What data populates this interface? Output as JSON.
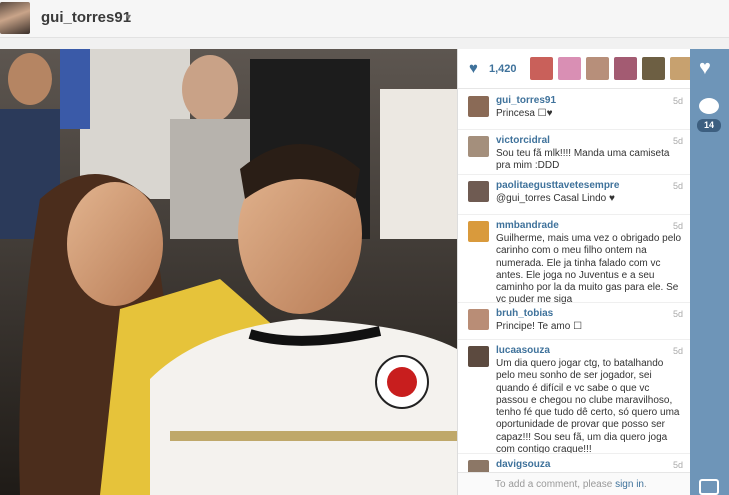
{
  "header": {
    "username": "gui_torres91",
    "caret": "▾"
  },
  "likes": {
    "count": "1,420",
    "heart": "♥"
  },
  "comments": [
    {
      "user": "gui_torres91",
      "time": "5d",
      "text": "Princesa ☐♥"
    },
    {
      "user": "victorcidral",
      "time": "5d",
      "text": "Sou teu fã mlk!!!! Manda uma camiseta pra mim :DDD"
    },
    {
      "user": "paolitaegusttavetesempre",
      "time": "5d",
      "text": "@gui_torres Casal Lindo ♥"
    },
    {
      "user": "mmbandrade",
      "time": "5d",
      "text": "Guilherme, mais uma vez o obrigado pelo carinho com o meu filho ontem na numerada. Ele ja tinha falado com vc antes. Ele joga no Juventus e a seu caminho por la da muito gas para ele. Se vc puder me siga"
    },
    {
      "user": "bruh_tobias",
      "time": "5d",
      "text": "Principe! Te amo ☐"
    },
    {
      "user": "lucaasouza",
      "time": "5d",
      "text": "Um dia quero jogar ctg, to batalhando pelo meu sonho de ser jogador, sei quando é difícil e vc sabe o que vc passou e chegou no clube maravilhoso, tenho fé que tudo dê certo, só quero uma oportunidade de provar que posso ser capaz!!! Sou seu fã, um dia quero joga com contigo craque!!!"
    },
    {
      "user": "davigsouza",
      "time": "5d",
      "text": ""
    }
  ],
  "add_comment": {
    "prefix": "To add a comment, please ",
    "link": "sign in",
    "suffix": "."
  },
  "sidebar": {
    "comment_count": "14"
  },
  "icons": {
    "like": "heart-icon",
    "comment": "comment-bubble-icon",
    "camera": "camera-icon"
  },
  "colors": {
    "link": "#3f729b",
    "sidebar": "#6e95b8"
  }
}
